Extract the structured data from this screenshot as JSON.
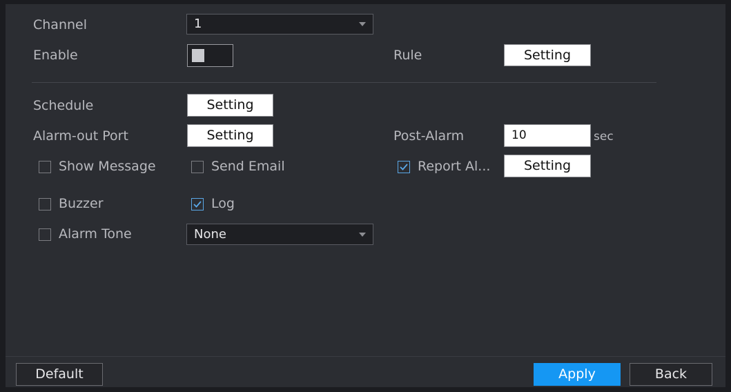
{
  "form": {
    "channel_label": "Channel",
    "channel_value": "1",
    "enable_label": "Enable",
    "enable_on": false,
    "rule_label": "Rule",
    "rule_button": "Setting",
    "schedule_label": "Schedule",
    "schedule_button": "Setting",
    "alarm_out_label": "Alarm-out Port",
    "alarm_out_button": "Setting",
    "post_alarm_label": "Post-Alarm",
    "post_alarm_value": "10",
    "post_alarm_unit": "sec",
    "show_message_label": "Show Message",
    "show_message_checked": false,
    "send_email_label": "Send Email",
    "send_email_checked": false,
    "report_alarm_label": "Report Al...",
    "report_alarm_checked": true,
    "report_alarm_button": "Setting",
    "buzzer_label": "Buzzer",
    "buzzer_checked": false,
    "log_label": "Log",
    "log_checked": true,
    "alarm_tone_label": "Alarm Tone",
    "alarm_tone_checked": false,
    "alarm_tone_value": "None"
  },
  "footer": {
    "default_label": "Default",
    "apply_label": "Apply",
    "back_label": "Back"
  },
  "colors": {
    "panel_bg": "#2b2d32",
    "accent": "#1597f3",
    "check": "#5aa8e8"
  }
}
